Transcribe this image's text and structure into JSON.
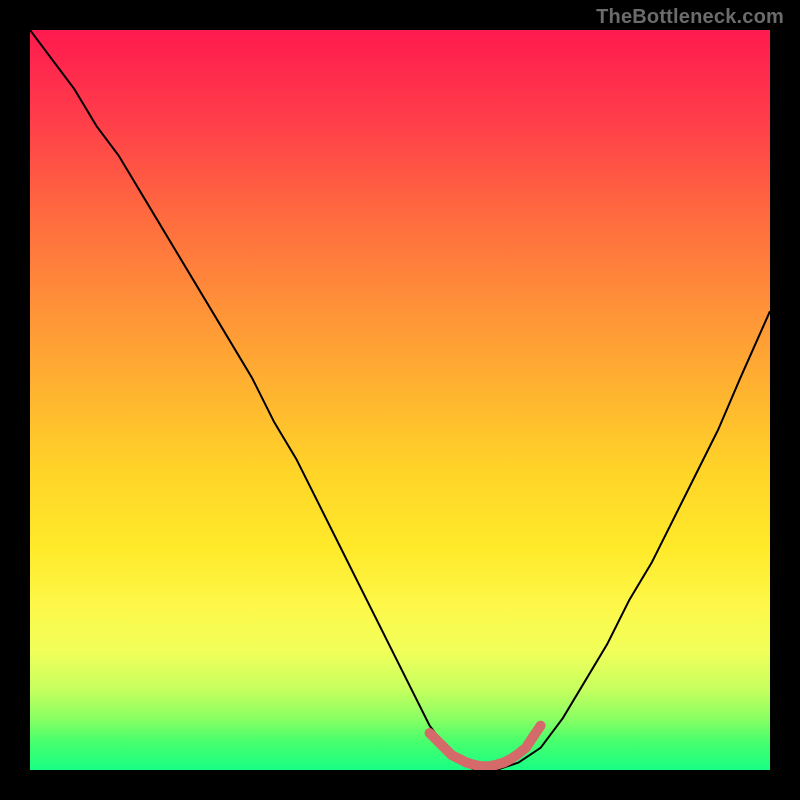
{
  "watermark": "TheBottleneck.com",
  "colors": {
    "frame": "#000000",
    "gradient_top": "#ff1a4f",
    "gradient_bottom": "#18ff84",
    "curve": "#000000",
    "segment": "#d46a6a"
  },
  "chart_data": {
    "type": "line",
    "title": "",
    "xlabel": "",
    "ylabel": "",
    "xlim": [
      0,
      100
    ],
    "ylim": [
      0,
      100
    ],
    "grid": false,
    "legend": false,
    "x": [
      0,
      3,
      6,
      9,
      12,
      15,
      18,
      21,
      24,
      27,
      30,
      33,
      36,
      39,
      42,
      45,
      48,
      51,
      54,
      57,
      60,
      63,
      66,
      69,
      72,
      75,
      78,
      81,
      84,
      87,
      90,
      93,
      96,
      100
    ],
    "values": [
      100,
      96,
      92,
      87,
      83,
      78,
      73,
      68,
      63,
      58,
      53,
      47,
      42,
      36,
      30,
      24,
      18,
      12,
      6,
      2,
      0,
      0,
      1,
      3,
      7,
      12,
      17,
      23,
      28,
      34,
      40,
      46,
      53,
      62
    ],
    "highlight_segment": {
      "x": [
        54,
        57,
        58,
        59,
        60,
        61,
        62,
        63,
        64,
        65,
        66,
        67,
        68,
        69
      ],
      "y": [
        5,
        2,
        1.5,
        1,
        0.7,
        0.5,
        0.5,
        0.7,
        1.0,
        1.5,
        2.2,
        3.0,
        4.5,
        6
      ]
    }
  }
}
